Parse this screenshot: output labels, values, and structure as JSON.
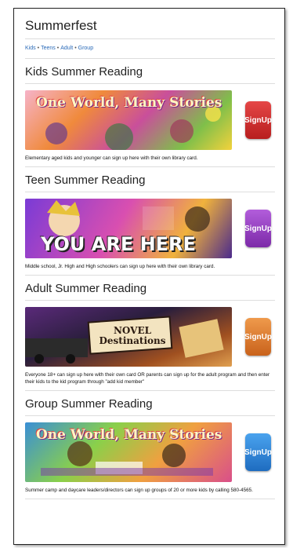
{
  "page": {
    "title": "Summerfest",
    "nav": [
      "Kids",
      "Teens",
      "Adult",
      "Group"
    ],
    "nav_separator": "•"
  },
  "sections": [
    {
      "title": "Kids Summer Reading",
      "banner_text": "One World, Many Stories",
      "signup_label": "Sign Up",
      "signup_color": "#d42a2a",
      "description": "Elementary aged kids and younger can sign up here with their own library card."
    },
    {
      "title": "Teen Summer Reading",
      "banner_text": "YOU ARE HERE",
      "signup_label": "Sign Up",
      "signup_color": "#9a3fc4",
      "description": "Middle school, Jr. High and High schoolers can sign up here with their own library card."
    },
    {
      "title": "Adult Summer Reading",
      "banner_text": "NOVEL Destinations",
      "signup_label": "Sign Up",
      "signup_color": "#e0782a",
      "description": "Everyone 18+ can sign up here with their own card OR parents can sign up for the adult program and then enter their kids to the kid program through \"add kid member\""
    },
    {
      "title": "Group Summer Reading",
      "banner_text": "One World, Many Stories",
      "signup_label": "Sign Up",
      "signup_color": "#2f86d8",
      "description": "Summer camp and daycare leaders/directors can sign up groups of 20 or more kids by calling 580-4565."
    }
  ]
}
